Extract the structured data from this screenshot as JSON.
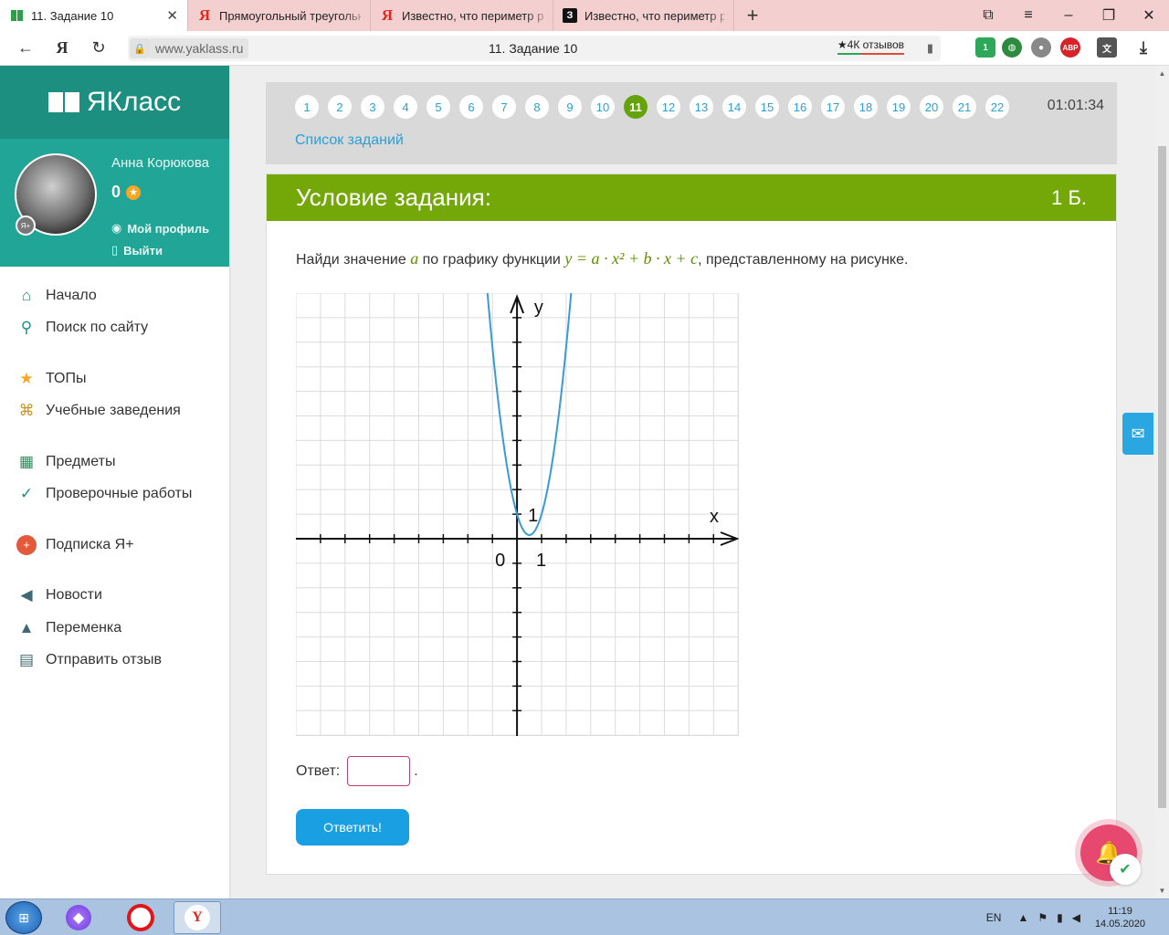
{
  "browser": {
    "tabs": [
      {
        "title": "11. Задание 10",
        "favicon": "yaklass-favicon",
        "active": true
      },
      {
        "title": "Прямоугольный треугольн",
        "favicon": "yandex-favicon",
        "active": false
      },
      {
        "title": "Известно, что периметр р",
        "favicon": "yandex-favicon",
        "active": false
      },
      {
        "title": "Известно, что периметр р",
        "favicon": "znanija-favicon",
        "active": false
      }
    ],
    "url_domain": "www.yaklass.ru",
    "page_title": "11. Задание 10",
    "reviews_label": "★4К отзывов",
    "ext_badge_count": "1",
    "abp_label": "ABP"
  },
  "sidebar": {
    "logo_text": "ЯКласс",
    "user": {
      "name": "Анна Корюкова",
      "count": "0",
      "badge": "Я+",
      "profile_link": "Мой профиль",
      "logout_link": "Выйти"
    },
    "menu": [
      {
        "label": "Начало",
        "icon": "home-icon",
        "glyph": "⌂"
      },
      {
        "label": "Поиск по сайту",
        "icon": "search-icon",
        "glyph": "⚲"
      },
      {
        "label": "ТОПы",
        "icon": "star-icon",
        "glyph": "★"
      },
      {
        "label": "Учебные заведения",
        "icon": "school-icon",
        "glyph": "🏛"
      },
      {
        "label": "Предметы",
        "icon": "book-icon",
        "glyph": "▦"
      },
      {
        "label": "Проверочные работы",
        "icon": "check-circle-icon",
        "glyph": "✓"
      },
      {
        "label": "Подписка Я+",
        "icon": "subscription-icon",
        "glyph": "+"
      },
      {
        "label": "Новости",
        "icon": "megaphone-icon",
        "glyph": "▸"
      },
      {
        "label": "Переменка",
        "icon": "bell-icon",
        "glyph": "♪"
      },
      {
        "label": "Отправить отзыв",
        "icon": "feedback-icon",
        "glyph": "☰"
      }
    ]
  },
  "task_nav": {
    "pages": [
      "1",
      "2",
      "3",
      "4",
      "5",
      "6",
      "7",
      "8",
      "9",
      "10",
      "11",
      "12",
      "13",
      "14",
      "15",
      "16",
      "17",
      "18",
      "19",
      "20",
      "21",
      "22"
    ],
    "current_page": "11",
    "timer": "01:01:34",
    "task_list_link": "Список заданий"
  },
  "task": {
    "header_title": "Условие задания:",
    "points": "1 Б.",
    "question_before": "Найди значение ",
    "question_var": "a",
    "question_mid": " по графику функции ",
    "question_formula": "y = a · x² + b · x + c",
    "question_after": ", представленному на рисунке.",
    "answer_label": "Ответ:",
    "answer_value": "",
    "answer_suffix": ".",
    "submit_label": "Ответить!"
  },
  "chart_data": {
    "type": "line",
    "title": "",
    "xlabel": "x",
    "ylabel": "y",
    "xlim": [
      -9,
      9
    ],
    "ylim": [
      -8,
      10
    ],
    "grid": true,
    "tick_labels": [
      "0",
      "1",
      "1"
    ],
    "series": [
      {
        "function": "y = a·x² + b·x + c",
        "color": "#3a9ad9",
        "points": [
          [
            -1.7,
            10
          ],
          [
            -1,
            4.4
          ],
          [
            0,
            1
          ],
          [
            0.5,
            0.5
          ],
          [
            1,
            1
          ],
          [
            2,
            4.4
          ],
          [
            2.7,
            10
          ]
        ]
      }
    ]
  },
  "taskbar": {
    "lang": "EN",
    "time": "11:19",
    "date": "14.05.2020"
  },
  "colors": {
    "brand": "#21a596",
    "header_green": "#73a808",
    "link_blue": "#2b9fd8",
    "curve": "#3a9ad9"
  }
}
